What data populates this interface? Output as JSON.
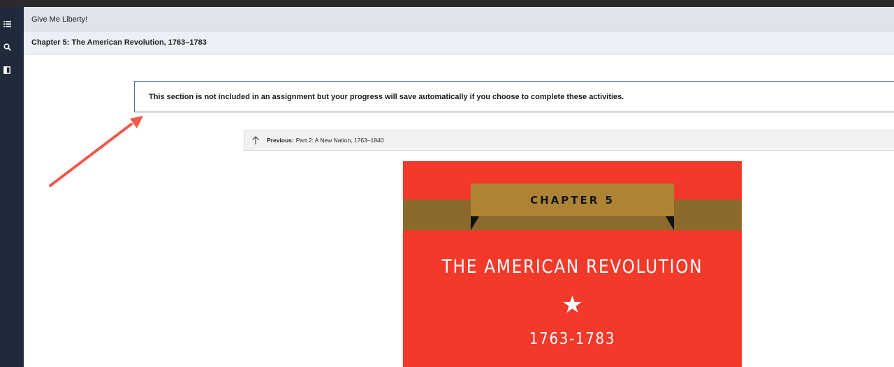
{
  "rail": {
    "icons": [
      "table-of-contents-icon",
      "search-icon",
      "notebook-icon"
    ]
  },
  "header": {
    "book_title": "Give Me Liberty!",
    "chapter_title": "Chapter 5: The American Revolution, 1763–1783"
  },
  "notice": {
    "text": "This section is not included in an assignment but your progress will save automatically if you choose to complete these activities."
  },
  "navigation": {
    "previous_label": "Previous:",
    "previous_text": "Part 2: A New Nation, 1763–1840"
  },
  "cover": {
    "chapter_label": "CHAPTER 5",
    "title": "THE AMERICAN REVOLUTION",
    "star": "★",
    "years": "1763-1783"
  },
  "colors": {
    "rail": "#1f2b3a",
    "cover_red": "#f2392a",
    "ribbon_gold": "#ad8435",
    "band_brown": "#8b6a2b",
    "annotation_arrow": "#ef5a4c"
  }
}
